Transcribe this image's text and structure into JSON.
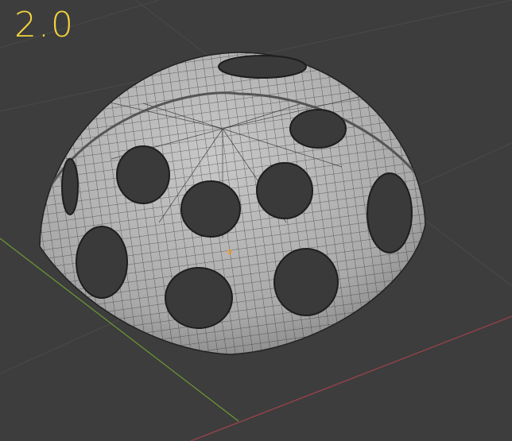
{
  "viewport": {
    "annotation_text": "2.0",
    "colors": {
      "background": "#3d3d3d",
      "grid": "#4a4a4a",
      "x_axis": "#a0434d",
      "y_axis": "#6e9a34",
      "mesh": "#b3b3b3",
      "wire": "#2a2a2a",
      "annotation": "#f2d33c",
      "origin": "#ff9a1f"
    }
  }
}
